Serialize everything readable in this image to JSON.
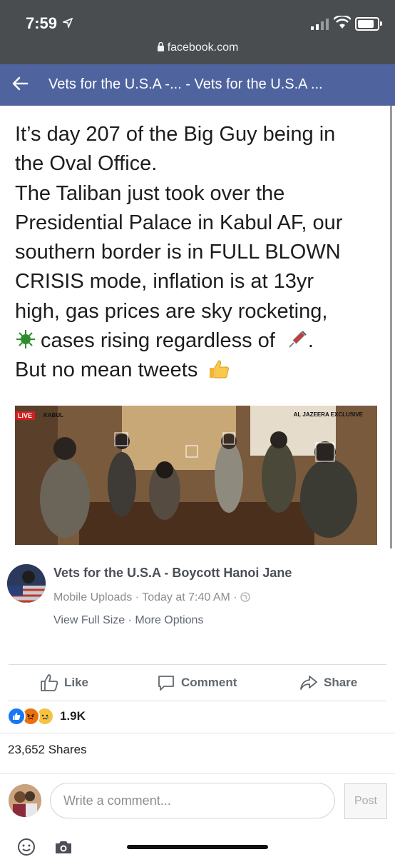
{
  "status_bar": {
    "time": "7:59",
    "url": "facebook.com"
  },
  "nav": {
    "title": "Vets for the U.S.A -... - Vets for the U.S.A ..."
  },
  "post": {
    "lines": [
      "It’s day 207 of the Big Guy being in",
      "the Oval Office.",
      "The Taliban just took over the",
      "Presidential Palace in Kabul AF, our",
      "southern border is in FULL BLOWN",
      "CRISIS mode, inflation is at 13yr",
      "high, gas prices are sky rocketing,",
      "cases rising regardless of",
      "But no mean tweets"
    ],
    "photo_tags": {
      "live": "LIVE",
      "kabul": "KABUL",
      "aj": "AL JAZEERA EXCLUSIVE"
    }
  },
  "meta": {
    "page_name": "Vets for the U.S.A - Boycott Hanoi Jane",
    "source": "Mobile Uploads",
    "timestamp": "Today at 7:40 AM",
    "view_full": "View Full Size",
    "more_options": "More Options"
  },
  "actions": {
    "like": "Like",
    "comment": "Comment",
    "share": "Share"
  },
  "reactions": {
    "count": "1.9K"
  },
  "shares": "23,652 Shares",
  "comment": {
    "placeholder": "Write a comment...",
    "post_label": "Post"
  },
  "colors": {
    "nav": "#4f639f",
    "status_bar": "#4a4d50",
    "like_blue": "#1877f2",
    "angry": "#e9710f"
  }
}
